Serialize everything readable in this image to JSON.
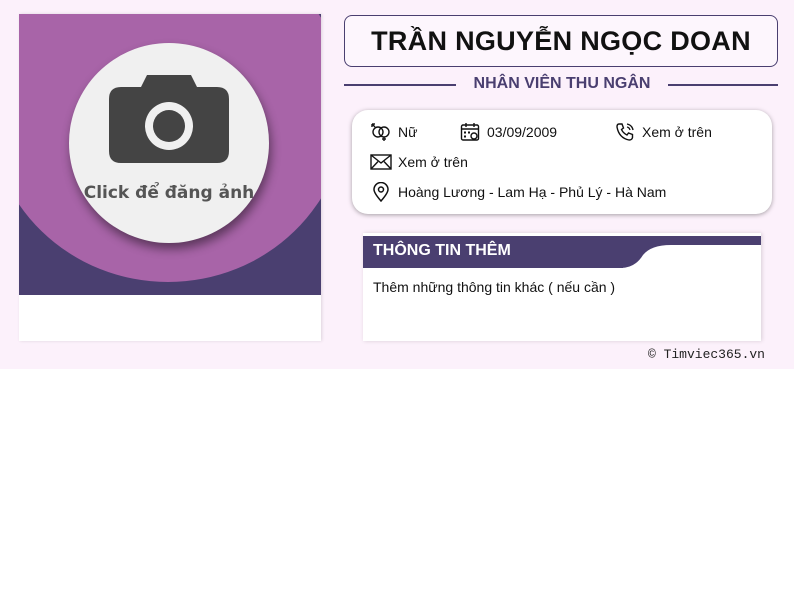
{
  "photo": {
    "upload_label": "Click để đăng ảnh",
    "icon": "camera-icon"
  },
  "header": {
    "name": "TRẦN NGUYỄN NGỌC DOAN",
    "job_title": "NHÂN VIÊN THU NGÂN"
  },
  "contact": {
    "gender": "Nữ",
    "birthday": "03/09/2009",
    "phone": "Xem ở trên",
    "email": "Xem ở trên",
    "address": "Hoàng Lương - Lam Hạ - Phủ Lý - Hà Nam",
    "icons": {
      "gender": "gender-icon",
      "birthday": "calendar-icon",
      "phone": "phone-icon",
      "email": "envelope-icon",
      "address": "map-pin-icon"
    }
  },
  "extra": {
    "title": "THÔNG TIN THÊM",
    "text": "Thêm những thông tin khác ( nếu cần )"
  },
  "footer": {
    "credit": "© Timviec365.vn"
  },
  "colors": {
    "brand_dark": "#4a3f70",
    "brand_purple": "#a864a8",
    "background": "#fcf1fb"
  }
}
